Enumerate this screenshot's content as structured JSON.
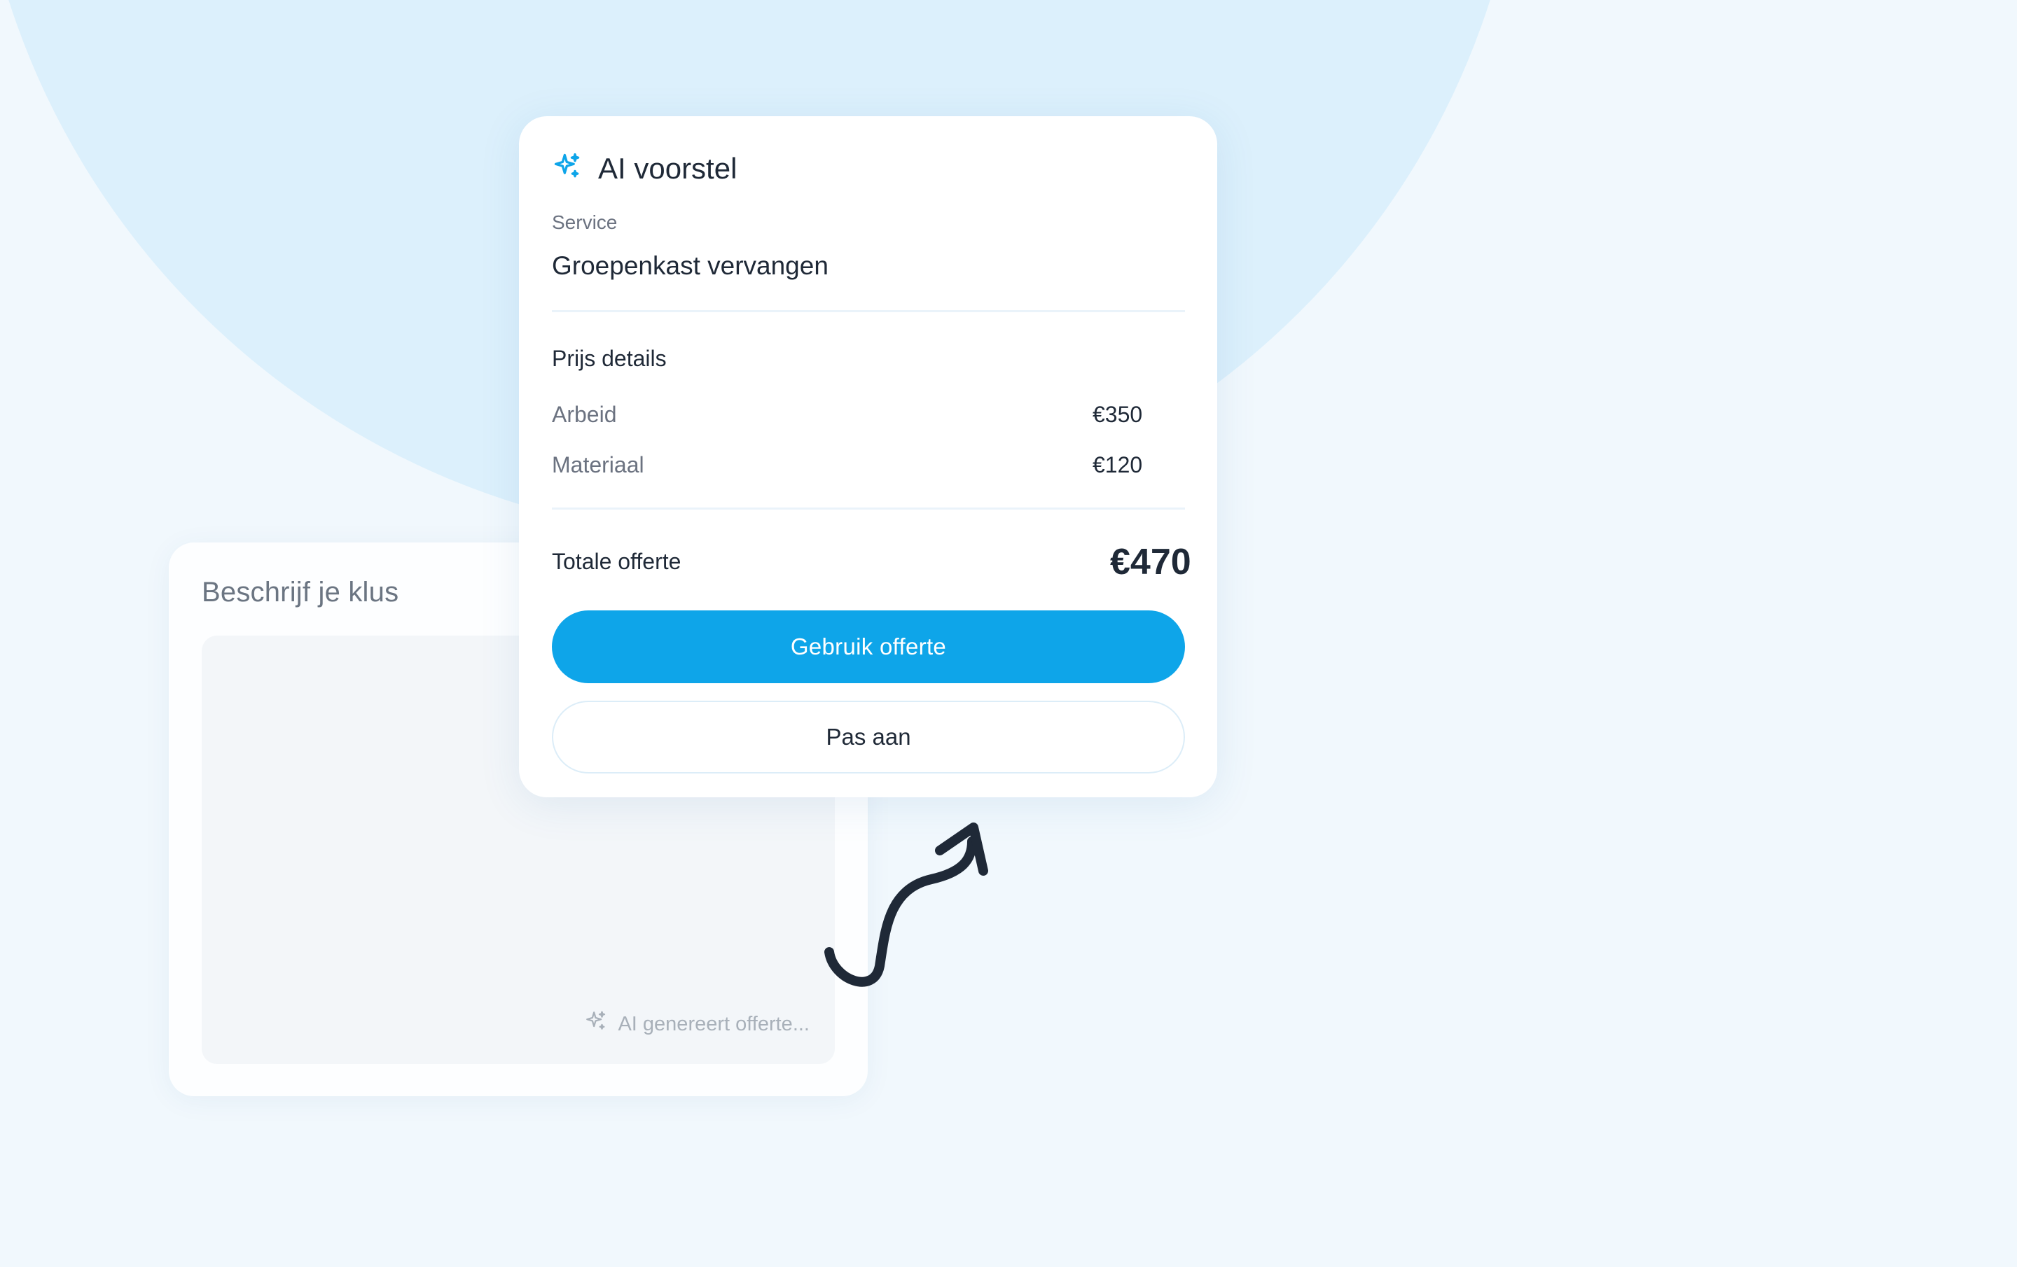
{
  "job_card": {
    "title": "Beschrijf je klus",
    "ai_status": "AI genereert offerte...",
    "status_icon": "sparkle-icon"
  },
  "ai_card": {
    "header_icon": "sparkle-icon",
    "title": "AI voorstel",
    "service_label": "Service",
    "service_value": "Groepenkast vervangen",
    "prijs_title": "Prijs details",
    "items": [
      {
        "label": "Arbeid",
        "value": "€350"
      },
      {
        "label": "Materiaal",
        "value": "€120"
      }
    ],
    "total_label": "Totale offerte",
    "total_value": "€470",
    "primary_button": "Gebruik offerte",
    "secondary_button": "Pas aan"
  },
  "colors": {
    "accent": "#0ea5e9",
    "background": "#f1f8fd",
    "circle": "#dcf0fc"
  }
}
